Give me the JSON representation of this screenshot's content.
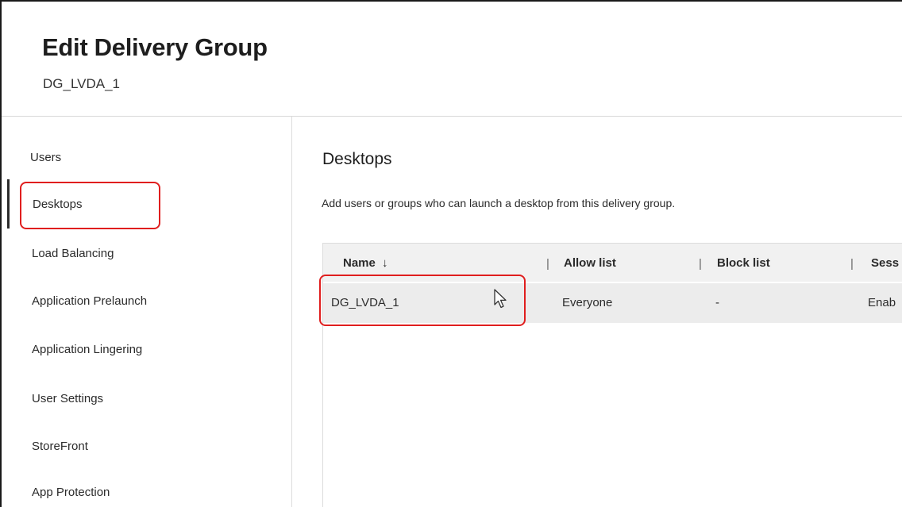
{
  "header": {
    "title": "Edit Delivery Group",
    "subtitle": "DG_LVDA_1"
  },
  "sidebar": {
    "items": [
      {
        "label": "Users"
      },
      {
        "label": "Desktops"
      },
      {
        "label": "Load Balancing"
      },
      {
        "label": "Application Prelaunch"
      },
      {
        "label": "Application Lingering"
      },
      {
        "label": "User Settings"
      },
      {
        "label": "StoreFront"
      },
      {
        "label": "App Protection"
      }
    ],
    "active": "Desktops"
  },
  "main": {
    "title": "Desktops",
    "description": "Add users or groups who can launch a desktop from this delivery group.",
    "table": {
      "columns": [
        "Name",
        "Allow list",
        "Block list",
        "Sess"
      ],
      "sort_indicator": "↓",
      "separator": "|",
      "rows": [
        {
          "name": "DG_LVDA_1",
          "allow_list": "Everyone",
          "block_list": "-",
          "session": "Enab"
        }
      ]
    }
  },
  "colors": {
    "highlight": "#e01e1e",
    "header_bg": "#f1f1f1",
    "row_bg": "#ececec"
  }
}
